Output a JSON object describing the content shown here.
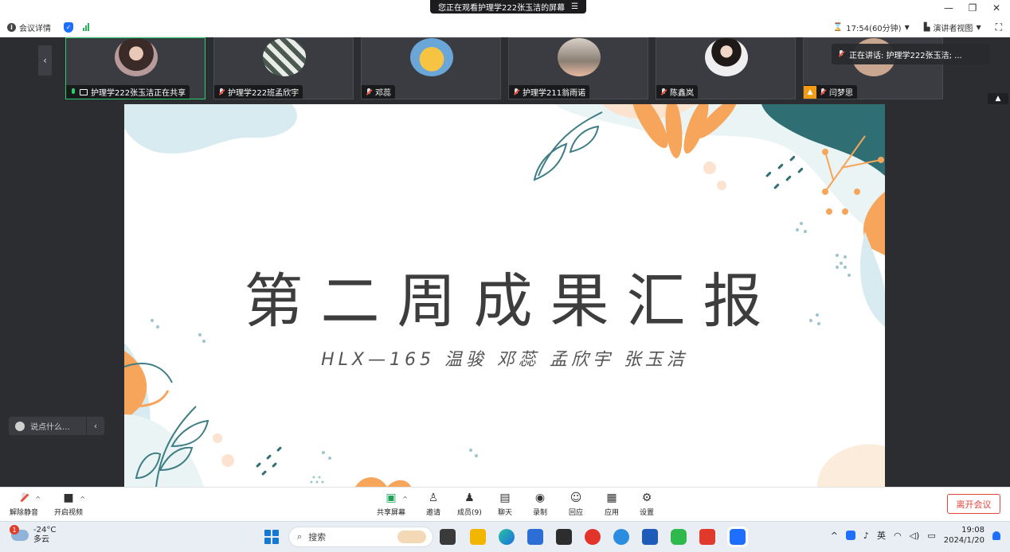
{
  "window": {
    "share_banner": "您正在观看护理学222张玉洁的屏幕",
    "minimize": "—",
    "restore": "❐",
    "close": "✕"
  },
  "toolbar": {
    "meeting_info": "会议详情",
    "timer": "17:54(60分钟)",
    "view_mode": "演讲者视图"
  },
  "participants": [
    {
      "name": "护理学222张玉洁正在共享",
      "active": true,
      "mic": "on",
      "sharing": true
    },
    {
      "name": "护理学222班孟欣宇",
      "mic": "off"
    },
    {
      "name": "邓蕊",
      "mic": "off"
    },
    {
      "name": "护理学211翁雨诺",
      "mic": "off"
    },
    {
      "name": "陈鑫岚",
      "mic": "off"
    },
    {
      "name": "闫梦思",
      "mic": "off",
      "host": true
    }
  ],
  "speaking": {
    "text": "正在讲话: 护理学222张玉洁; ..."
  },
  "slide": {
    "title": "第二周成果汇报",
    "subtitle": "HLX—165 温骏 邓蕊 孟欣宇 张玉洁"
  },
  "chat": {
    "placeholder": "说点什么...",
    "expand": "‹"
  },
  "controls": {
    "unmute": "解除静音",
    "start_video": "开启视频",
    "share_screen": "共享屏幕",
    "invite": "邀请",
    "members": "成员(9)",
    "chat": "聊天",
    "record": "录制",
    "reactions": "回应",
    "apps": "应用",
    "settings": "设置",
    "leave": "离开会议"
  },
  "taskbar": {
    "weather_badge": "1",
    "temperature": "-24°C",
    "weather": "多云",
    "search_placeholder": "搜索",
    "ime": "英",
    "time": "19:08",
    "date": "2024/1/20"
  },
  "colors": {
    "accent_blue": "#1e6fff",
    "leave_red": "#e0463c",
    "active_green": "#2ecc71",
    "slide_orange": "#f6a55a",
    "slide_teal": "#2f6f73",
    "slide_lightblue": "#cfe6ec"
  }
}
